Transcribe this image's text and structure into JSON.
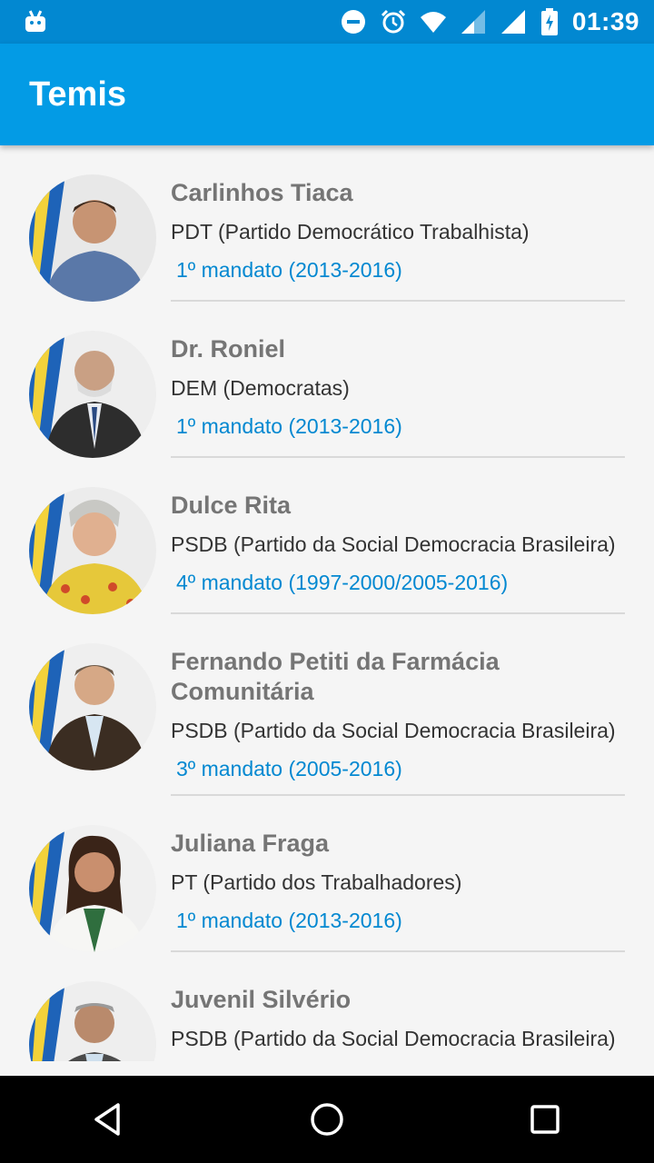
{
  "status_bar": {
    "time": "01:39",
    "icons": [
      "android-icon",
      "do-not-disturb-icon",
      "alarm-icon",
      "wifi-icon",
      "signal-icon",
      "signal-full-icon",
      "battery-charging-icon"
    ]
  },
  "app_bar": {
    "title": "Temis"
  },
  "councillors": [
    {
      "name": "Carlinhos Tiaca",
      "party": "PDT (Partido Democrático Trabalhista)",
      "term": "1º mandato (2013-2016)"
    },
    {
      "name": "Dr. Roniel",
      "party": "DEM (Democratas)",
      "term": "1º mandato (2013-2016)"
    },
    {
      "name": "Dulce Rita",
      "party": "PSDB (Partido da Social Democracia Brasileira)",
      "term": "4º mandato (1997-2000/2005-2016)"
    },
    {
      "name": "Fernando Petiti da Farmácia Comunitária",
      "party": "PSDB (Partido da Social Democracia Brasileira)",
      "term": "3º mandato (2005-2016)"
    },
    {
      "name": "Juliana Fraga",
      "party": "PT (Partido dos Trabalhadores)",
      "term": "1º mandato (2013-2016)"
    },
    {
      "name": "Juvenil Silvério",
      "party": "PSDB (Partido da Social Democracia Brasileira)",
      "term": ""
    }
  ],
  "nav_bar": {
    "icons": [
      "back-icon",
      "home-icon",
      "recents-icon"
    ]
  },
  "colors": {
    "status_bar": "#0288d1",
    "app_bar": "#039be5",
    "term_text": "#0288d1",
    "name_text": "#757575"
  }
}
